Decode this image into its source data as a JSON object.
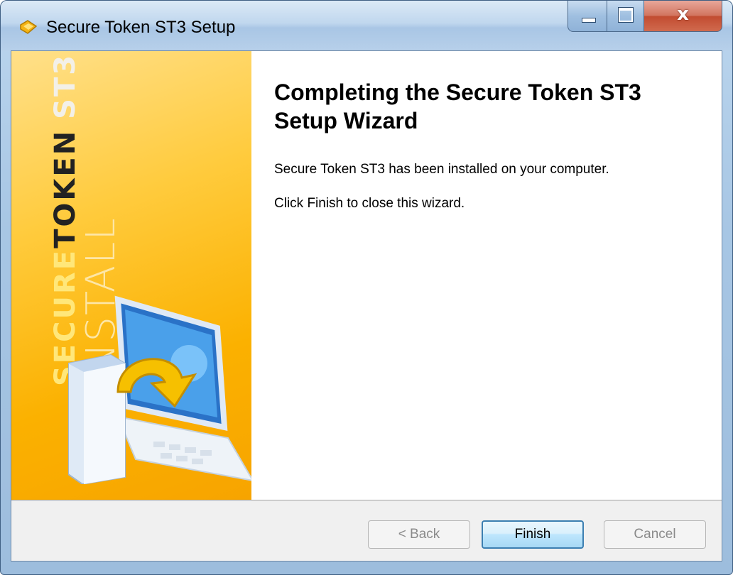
{
  "window": {
    "title": "Secure Token ST3 Setup",
    "icon": "installer-arrow-icon"
  },
  "caption_buttons": {
    "minimize_icon": "minimize-icon",
    "maximize_icon": "maximize-icon",
    "close_glyph": "x"
  },
  "banner": {
    "brand_secure": "SECURE",
    "brand_token": "TOKEN",
    "brand_model": "ST3",
    "install_text": "INSTALL",
    "colors": {
      "top": "#ffe08a",
      "bottom": "#f7a400"
    }
  },
  "content": {
    "heading": "Completing the Secure Token ST3 Setup Wizard",
    "line1": "Secure Token ST3 has been installed on your computer.",
    "line2": "Click Finish to close this wizard."
  },
  "buttons": {
    "back": "< Back",
    "finish": "Finish",
    "cancel": "Cancel"
  }
}
